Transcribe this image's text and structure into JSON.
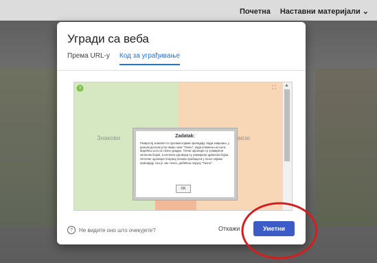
{
  "topnav": {
    "home": "Почетна",
    "materials": "Наставни материјали"
  },
  "dialog": {
    "title": "Угради са веба",
    "tabs": [
      {
        "label": "Према URL-у",
        "active": false
      },
      {
        "label": "Код за уграђивање",
        "active": true
      }
    ]
  },
  "game": {
    "left_heading": "Знакови",
    "right_heading": "везе",
    "modal": {
      "title": "Zadatak:",
      "body": "Разврстај знакове по групама којима припадају.\nКада завршиш, у доњем десном углу имаш знак \"Тачно\", када кликнеш на њега, видећеш шта си тачно урадио. Тачни одговори су уоквирени зеленом бојом, а нетачни одговори су уоквирени црвеном бојом. Нетачне одговоре покушај поново пребацити у поље којима припадају.\nАко је све тачно, добићеш поруку \"Тачно\"",
      "ok": "OK"
    }
  },
  "footer": {
    "help": "Не видите оно што очекујете?",
    "cancel": "Откажи",
    "insert": "Уметни"
  },
  "colors": {
    "accent": "#1a73e8",
    "insert_bg": "#3c5bc7",
    "annotation": "#d41e1e"
  }
}
